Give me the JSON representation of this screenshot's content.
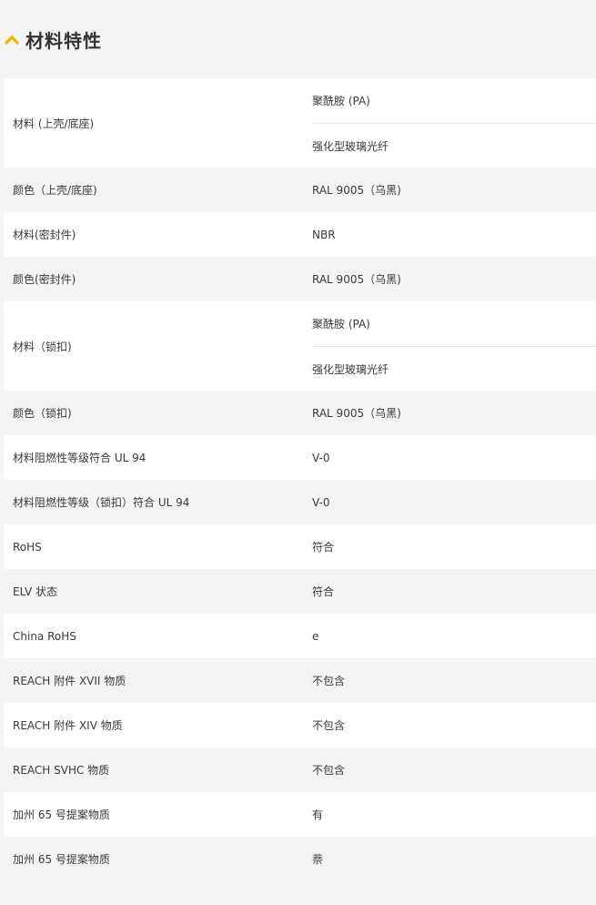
{
  "section": {
    "title": "材料特性",
    "icon": "chevron-up-icon",
    "accent_color": "#f2b600"
  },
  "rows": [
    {
      "label": "材料 (上壳/底座)",
      "values": [
        "聚酰胺 (PA)",
        "强化型玻璃光纤"
      ]
    },
    {
      "label": "颜色（上壳/底座)",
      "values": [
        "RAL 9005（乌黑)"
      ]
    },
    {
      "label": "材料(密封件)",
      "values": [
        "NBR"
      ]
    },
    {
      "label": "颜色(密封件)",
      "values": [
        "RAL 9005（乌黑)"
      ]
    },
    {
      "label": "材料（锁扣)",
      "values": [
        "聚酰胺 (PA)",
        "强化型玻璃光纤"
      ]
    },
    {
      "label": "颜色（锁扣)",
      "values": [
        "RAL 9005（乌黑)"
      ]
    },
    {
      "label": "材料阻燃性等级符合 UL 94",
      "values": [
        "V-0"
      ]
    },
    {
      "label": "材料阻燃性等级（锁扣）符合 UL 94",
      "values": [
        "V-0"
      ]
    },
    {
      "label": "RoHS",
      "values": [
        "符合"
      ]
    },
    {
      "label": "ELV 状态",
      "values": [
        "符合"
      ]
    },
    {
      "label": "China RoHS",
      "values": [
        "e"
      ]
    },
    {
      "label": "REACH 附件 XVII 物质",
      "values": [
        "不包含"
      ]
    },
    {
      "label": "REACH 附件 XIV 物质",
      "values": [
        "不包含"
      ]
    },
    {
      "label": "REACH SVHC 物质",
      "values": [
        "不包含"
      ]
    },
    {
      "label": "加州 65 号提案物质",
      "values": [
        "有"
      ]
    },
    {
      "label": "加州 65 号提案物质",
      "values": [
        "萘"
      ]
    }
  ]
}
